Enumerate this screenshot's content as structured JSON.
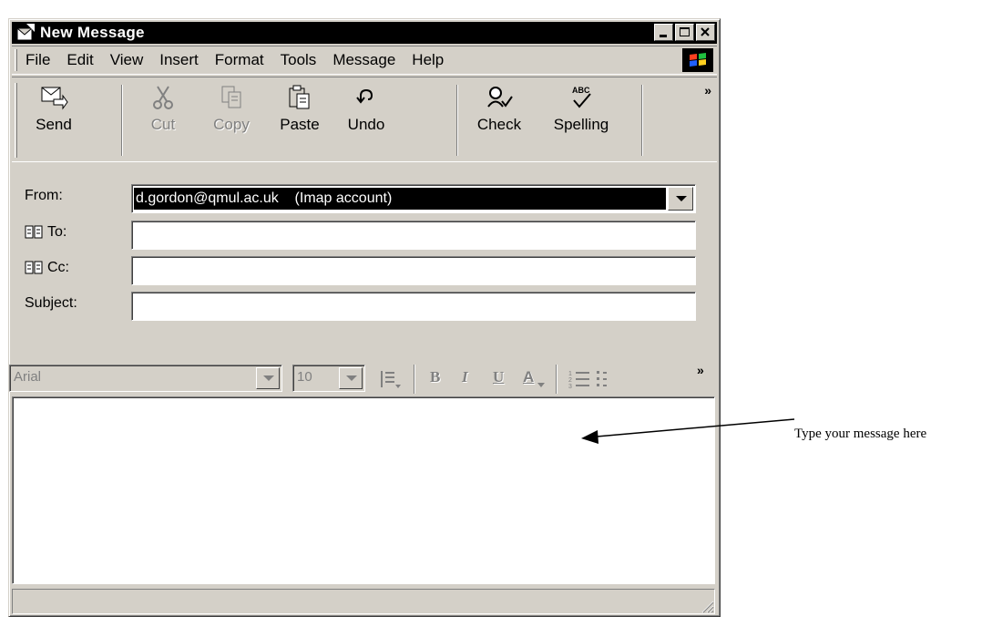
{
  "window": {
    "title": "New Message"
  },
  "menu": [
    "File",
    "Edit",
    "View",
    "Insert",
    "Format",
    "Tools",
    "Message",
    "Help"
  ],
  "toolbar": {
    "send": "Send",
    "cut": "Cut",
    "copy": "Copy",
    "paste": "Paste",
    "undo": "Undo",
    "check": "Check",
    "spelling": "Spelling",
    "more": "»"
  },
  "header": {
    "from_label": "From:",
    "from_value": "d.gordon@qmul.ac.uk    (Imap account)",
    "to_label": "To:",
    "to_value": "",
    "cc_label": "Cc:",
    "cc_value": "",
    "subject_label": "Subject:",
    "subject_value": ""
  },
  "format": {
    "font_name": "Arial",
    "font_size": "10",
    "bold": "B",
    "italic": "I",
    "underline": "U",
    "font_color": "A",
    "more": "»"
  },
  "message_body": "",
  "annotation": {
    "text": "Type your message here"
  },
  "colors": {
    "chrome": "#d4d0c8",
    "titlebar": "#000000",
    "disabled": "#808080"
  }
}
